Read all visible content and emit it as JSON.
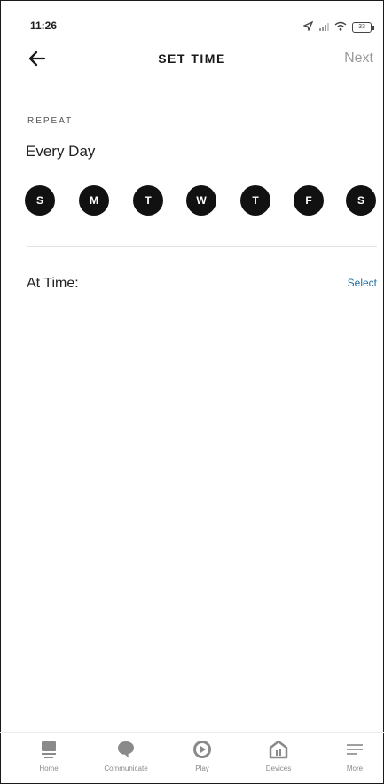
{
  "status_bar": {
    "time": "11:26",
    "battery": "33"
  },
  "header": {
    "title": "SET TIME",
    "next_label": "Next"
  },
  "repeat": {
    "section_label": "REPEAT",
    "value": "Every Day",
    "days": [
      "S",
      "M",
      "T",
      "W",
      "T",
      "F",
      "S"
    ]
  },
  "time_row": {
    "label": "At Time:",
    "action": "Select"
  },
  "tabs": [
    {
      "label": "Home",
      "icon": "home-icon"
    },
    {
      "label": "Communicate",
      "icon": "chat-bubble-icon"
    },
    {
      "label": "Play",
      "icon": "play-icon"
    },
    {
      "label": "Devices",
      "icon": "devices-icon"
    },
    {
      "label": "More",
      "icon": "menu-icon"
    }
  ],
  "colors": {
    "day_circle": "#111111",
    "accent_link": "#1f6f9e",
    "muted": "#9a9a9a"
  }
}
